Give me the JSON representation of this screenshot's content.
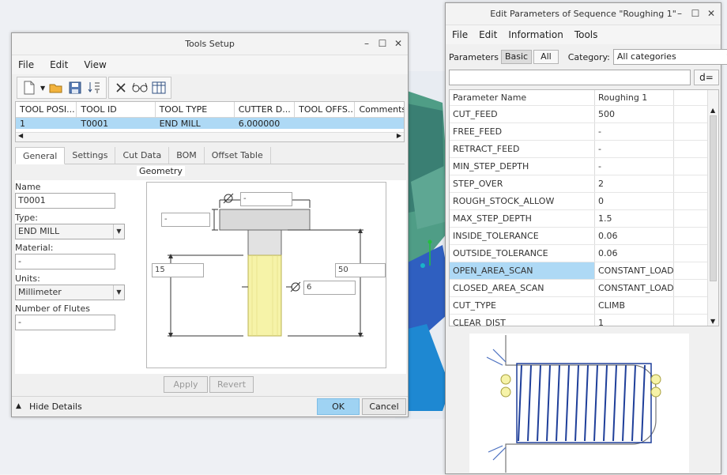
{
  "tools_window": {
    "title": "Tools Setup",
    "menu": [
      "File",
      "Edit",
      "View"
    ],
    "table": {
      "headers": [
        "TOOL POSI...",
        "TOOL ID",
        "TOOL TYPE",
        "CUTTER D...",
        "TOOL OFFS...",
        "Comments"
      ],
      "rows": [
        [
          "1",
          "T0001",
          "END MILL",
          "6.000000",
          "",
          ""
        ]
      ]
    },
    "tabs": [
      "General",
      "Settings",
      "Cut Data",
      "BOM",
      "Offset Table"
    ],
    "fields": {
      "name_label": "Name",
      "name_value": "T0001",
      "type_label": "Type:",
      "type_value": "END MILL",
      "material_label": "Material:",
      "material_value": "-",
      "units_label": "Units:",
      "units_value": "Millimeter",
      "flutes_label": "Number of Flutes",
      "flutes_value": "-"
    },
    "geometry": {
      "title": "Geometry",
      "top_diameter": "-",
      "head_height": "-",
      "length_left": "15",
      "length_right": "50",
      "cutter_diameter": "6"
    },
    "buttons": {
      "apply": "Apply",
      "revert": "Revert",
      "hide_details": "Hide Details",
      "ok": "OK",
      "cancel": "Cancel"
    }
  },
  "params_window": {
    "title": "Edit Parameters of Sequence \"Roughing 1\"",
    "menu": [
      "File",
      "Edit",
      "Information",
      "Tools"
    ],
    "parameters_label": "Parameters",
    "basic": "Basic",
    "all": "All",
    "category_label": "Category:",
    "category_value": "All categories",
    "formula_button": "d=",
    "table_headers": [
      "Parameter Name",
      "Roughing 1"
    ],
    "rows": [
      {
        "name": "CUT_FEED",
        "value": "500"
      },
      {
        "name": "FREE_FEED",
        "value": "-"
      },
      {
        "name": "RETRACT_FEED",
        "value": "-"
      },
      {
        "name": "MIN_STEP_DEPTH",
        "value": "-"
      },
      {
        "name": "STEP_OVER",
        "value": "2"
      },
      {
        "name": "ROUGH_STOCK_ALLOW",
        "value": "0"
      },
      {
        "name": "MAX_STEP_DEPTH",
        "value": "1.5"
      },
      {
        "name": "INSIDE_TOLERANCE",
        "value": "0.06"
      },
      {
        "name": "OUTSIDE_TOLERANCE",
        "value": "0.06"
      },
      {
        "name": "OPEN_AREA_SCAN",
        "value": "CONSTANT_LOAD"
      },
      {
        "name": "CLOSED_AREA_SCAN",
        "value": "CONSTANT_LOAD"
      },
      {
        "name": "CUT_TYPE",
        "value": "CLIMB"
      },
      {
        "name": "CLEAR_DIST",
        "value": "1"
      }
    ]
  },
  "colors": {
    "selection": "#aed9f5",
    "ok_button": "#9fd3f3",
    "toolpath": "#1f3f9a",
    "cutter_highlight": "#f6f3a8"
  }
}
